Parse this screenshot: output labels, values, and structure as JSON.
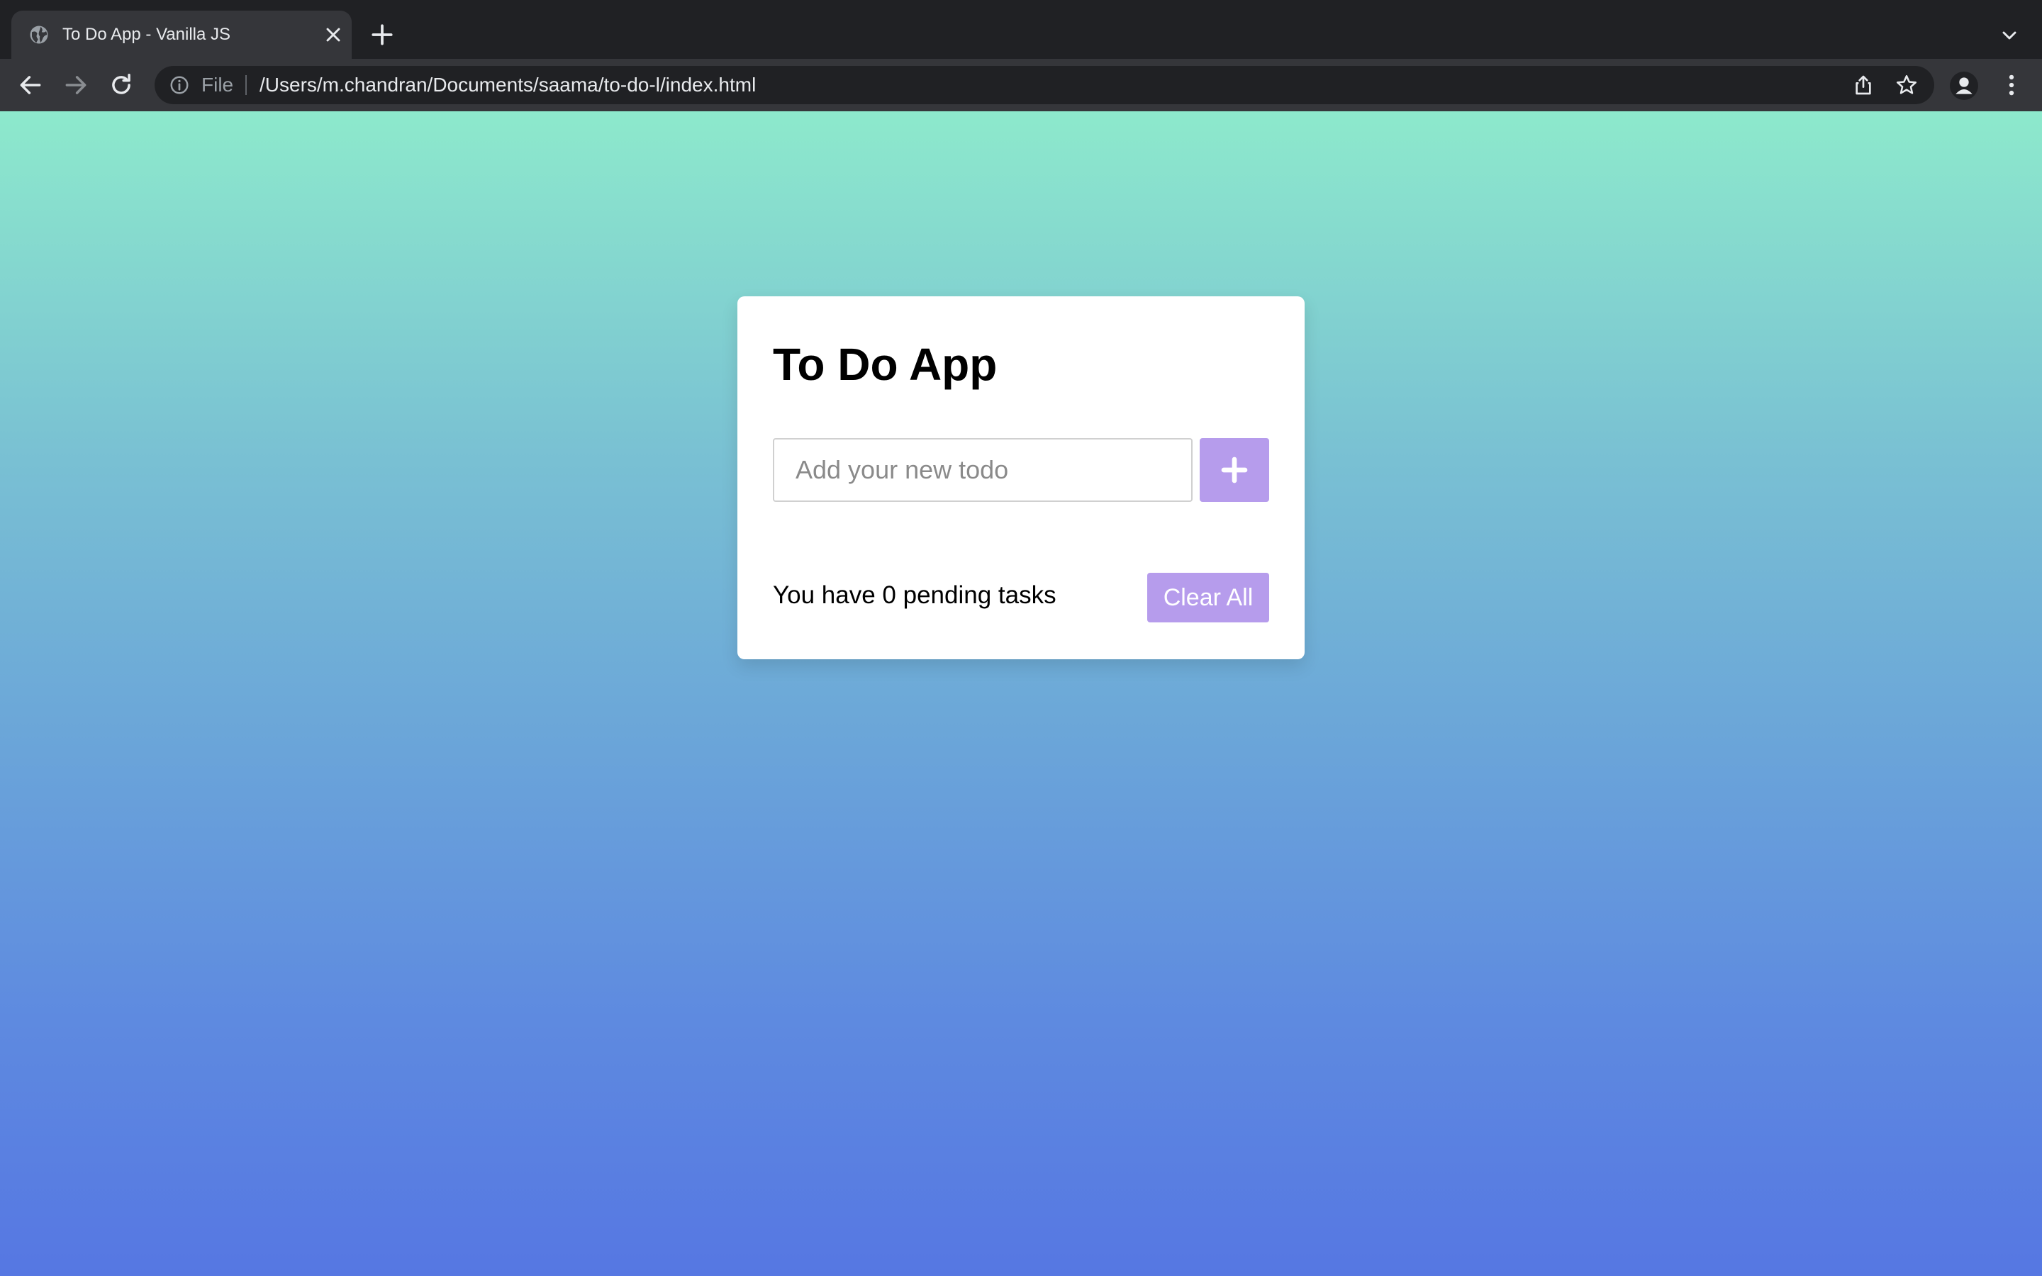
{
  "browser": {
    "tab": {
      "title": "To Do App - Vanilla JS"
    },
    "omnibox": {
      "scheme": "File",
      "url": "/Users/m.chandran/Documents/saama/to-do-l/index.html"
    }
  },
  "app": {
    "title": "To Do App",
    "input": {
      "placeholder": "Add your new todo",
      "value": ""
    },
    "add_icon": "plus-icon",
    "pending_prefix": "You have ",
    "pending_count": "0",
    "pending_suffix": " pending tasks",
    "clear_label": "Clear All",
    "colors": {
      "accent": "#b69cec",
      "gradient_top": "#8de9cc",
      "gradient_bottom": "#5677e2"
    }
  }
}
